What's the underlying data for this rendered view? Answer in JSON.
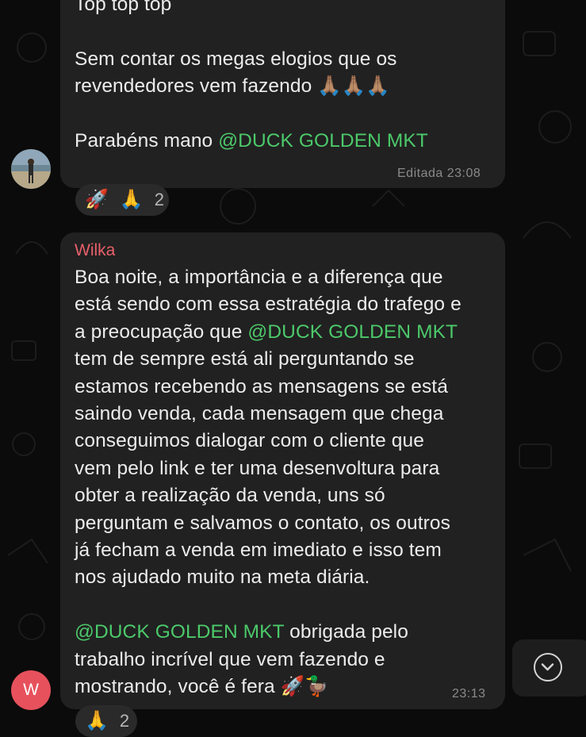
{
  "colors": {
    "background": "#0b0b0b",
    "bubble": "#212121",
    "mention": "#4cc96a",
    "sender_wilka": "#e8606a",
    "avatar_w": "#e6515c"
  },
  "message1": {
    "lines": [
      "Top top top",
      "",
      "Sem contar os megas elogios que os",
      "revendedores vem fazendo 🙏🏽🙏🏽🙏🏽",
      "",
      "Parabéns mano "
    ],
    "mention": "@DUCK GOLDEN MKT",
    "time": "Editada 23:08",
    "reactions": {
      "emojis": [
        "🚀",
        "🙏"
      ],
      "count": "2"
    }
  },
  "message2": {
    "sender": "Wilka",
    "line1": "Boa noite, a importância e a diferença que",
    "line2": "está sendo com essa estratégia do trafego e",
    "line3_prefix": "a preocupação que ",
    "line3_mention": "@DUCK GOLDEN MKT",
    "body_rest": [
      "tem de sempre está ali perguntando se",
      "estamos recebendo as mensagens se está",
      "saindo venda, cada mensagem que chega",
      "conseguimos dialogar com o cliente que",
      "vem pelo link e ter uma desenvoltura para",
      "obter a realização da venda, uns só",
      "perguntam e salvamos o contato, os outros",
      "já fecham a venda em imediato e isso tem",
      "nos ajudado muito na meta diária."
    ],
    "closing_mention": "@DUCK GOLDEN MKT",
    "closing_suffix": " obrigada pelo",
    "closing_line2": "trabalho incrível que vem fazendo e",
    "closing_line3": "mostrando, você é fera 🚀🦆",
    "time": "23:13",
    "avatar_initial": "W",
    "reactions": {
      "emojis": [
        "🙏"
      ],
      "count": "2"
    }
  },
  "scroll_button": {
    "icon": "chevron-down-icon"
  }
}
